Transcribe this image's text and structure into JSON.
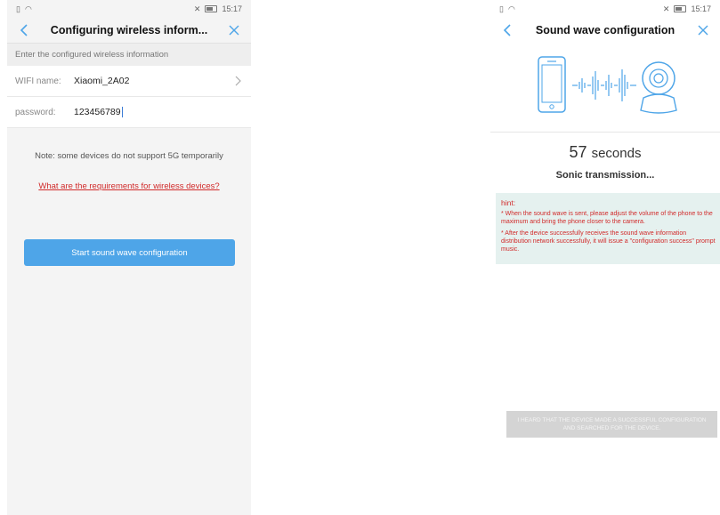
{
  "left": {
    "status": {
      "time": "15:17"
    },
    "nav": {
      "title": "Configuring wireless inform..."
    },
    "section_hint": "Enter the configured wireless information",
    "wifi": {
      "label": "WIFI name:",
      "value": "Xiaomi_2A02"
    },
    "password": {
      "label": "password:",
      "value": "123456789"
    },
    "note": "Note: some devices do not support 5G temporarily",
    "requirements_link": "What are the requirements for wireless devices?",
    "start_button": "Start sound wave configuration"
  },
  "right": {
    "status": {
      "time": "15:17"
    },
    "nav": {
      "title": "Sound wave configuration"
    },
    "countdown": {
      "value": "57",
      "unit": "seconds"
    },
    "transmission_text": "Sonic transmission...",
    "hint": {
      "title": "hint:",
      "lines": [
        "* When the sound wave is sent, please adjust the volume of the phone to the maximum and bring the phone closer to the camera.",
        "* After the device successfully receives the sound wave information distribution network successfully, it will issue a \"configuration success\" prompt music."
      ]
    },
    "heard_button": "I HEARD THAT THE DEVICE MADE A SUCCESSFUL CONFIGURATION AND SEARCHED FOR THE DEVICE."
  },
  "colors": {
    "accent": "#4ea5e8",
    "link_red": "#d12a2a",
    "hint_bg": "#e5f1ef",
    "disabled": "#d4d4d4"
  }
}
